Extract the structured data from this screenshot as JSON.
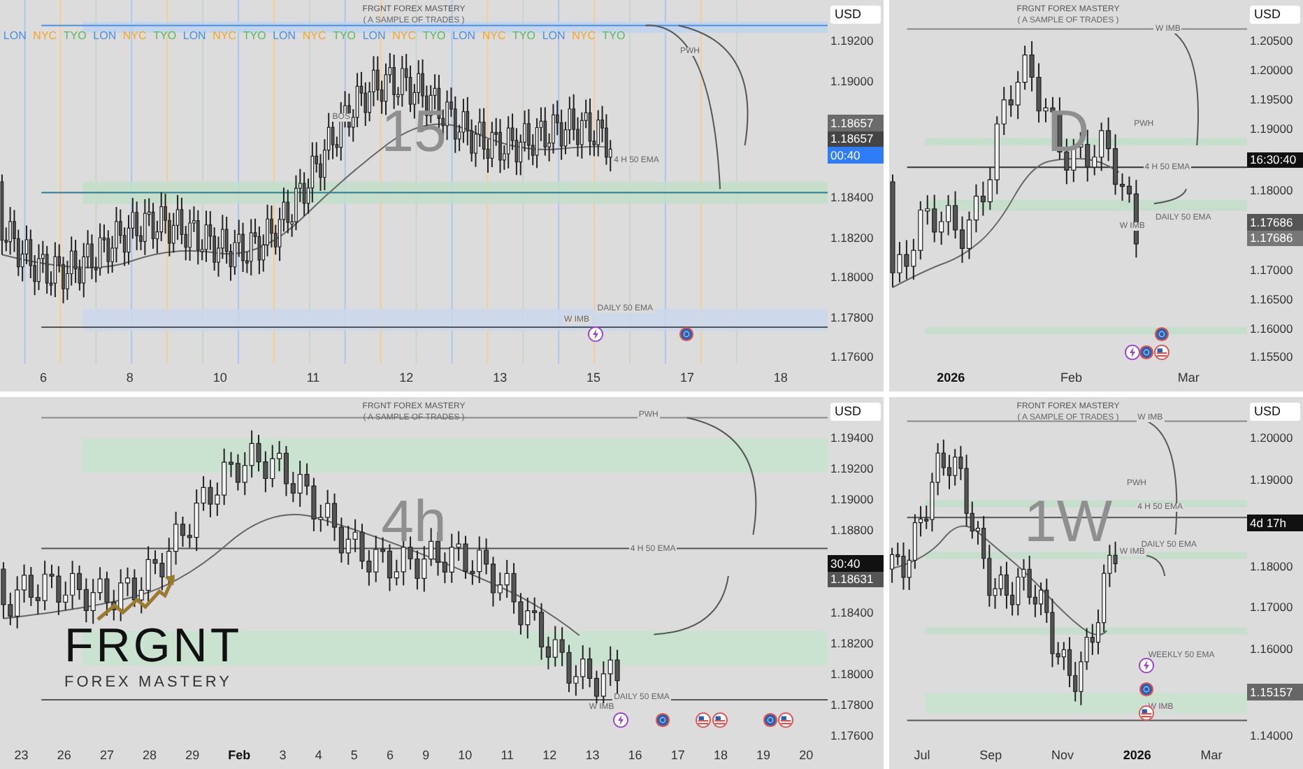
{
  "panels": [
    {
      "timeframe": "15",
      "currency": "USD",
      "title": "FRGNT FOREX MASTERY",
      "subtitle": "( A SAMPLE OF TRADES )",
      "sessions": [
        {
          "text": "LON",
          "color": "#4a90e2"
        },
        {
          "text": "NYC",
          "color": "#f5a623"
        },
        {
          "text": "TYO",
          "color": "#5cb85c"
        },
        {
          "text": "LON",
          "color": "#4a90e2"
        },
        {
          "text": "NYC",
          "color": "#f5a623"
        },
        {
          "text": "TYO",
          "color": "#5cb85c"
        },
        {
          "text": "LON",
          "color": "#4a90e2"
        },
        {
          "text": "NYC",
          "color": "#f5a623"
        },
        {
          "text": "TYO",
          "color": "#5cb85c"
        },
        {
          "text": "LON",
          "color": "#4a90e2"
        },
        {
          "text": "NYC",
          "color": "#f5a623"
        },
        {
          "text": "TYO",
          "color": "#5cb85c"
        },
        {
          "text": "LON",
          "color": "#4a90e2"
        },
        {
          "text": "NYC",
          "color": "#f5a623"
        },
        {
          "text": "TYO",
          "color": "#5cb85c"
        },
        {
          "text": "LON",
          "color": "#4a90e2"
        },
        {
          "text": "NYC",
          "color": "#f5a623"
        },
        {
          "text": "TYO",
          "color": "#5cb85c"
        },
        {
          "text": "LON",
          "color": "#4a90e2"
        },
        {
          "text": "NYC",
          "color": "#f5a623"
        },
        {
          "text": "TYO",
          "color": "#5cb85c"
        }
      ],
      "level_labels": [
        "PWH",
        "BOS",
        "4 H 50 EMA",
        "DAILY 50 EMA",
        "W IMB"
      ],
      "axis": [
        {
          "kind": "tick",
          "text": "1.19200"
        },
        {
          "kind": "tick",
          "text": "1.19000"
        },
        {
          "kind": "tags",
          "tags": [
            {
              "text": "1.18657",
              "color": "#6b6b6b"
            },
            {
              "text": "1.18657",
              "color": "#444444"
            },
            {
              "text": "00:40",
              "color": "#2f7df6"
            }
          ]
        },
        {
          "kind": "tick",
          "text": "1.18400"
        },
        {
          "kind": "tick",
          "text": "1.18200"
        },
        {
          "kind": "tick",
          "text": "1.18000"
        },
        {
          "kind": "tick",
          "text": "1.17800"
        },
        {
          "kind": "tick",
          "text": "1.17600"
        }
      ],
      "time_labels": [
        {
          "text": "6",
          "major": false
        },
        {
          "text": "8",
          "major": false
        },
        {
          "text": "10",
          "major": false
        },
        {
          "text": "11",
          "major": false
        },
        {
          "text": "12",
          "major": false
        },
        {
          "text": "13",
          "major": false
        },
        {
          "text": "15",
          "major": false
        },
        {
          "text": "17",
          "major": false
        },
        {
          "text": "18",
          "major": false
        }
      ]
    },
    {
      "timeframe": "D",
      "currency": "USD",
      "title": "FRGNT FOREX MASTERY",
      "subtitle": "( A SAMPLE OF TRADES )",
      "level_labels": [
        "W IMB",
        "PWH",
        "4 H 50 EMA",
        "DAILY 50 EMA",
        "W IMB"
      ],
      "axis": [
        {
          "kind": "tick",
          "text": "1.20500"
        },
        {
          "kind": "tick",
          "text": "1.20000"
        },
        {
          "kind": "tick",
          "text": "1.19500"
        },
        {
          "kind": "tick",
          "text": "1.19000"
        },
        {
          "kind": "tags",
          "tags": [
            {
              "text": "16:30:40",
              "color": "#111111"
            }
          ]
        },
        {
          "kind": "tick",
          "text": "1.18000"
        },
        {
          "kind": "tags",
          "tags": [
            {
              "text": "1.17686",
              "color": "#555555"
            },
            {
              "text": "1.17686",
              "color": "#777777"
            }
          ]
        },
        {
          "kind": "tick",
          "text": "1.17000"
        },
        {
          "kind": "tick",
          "text": "1.16500"
        },
        {
          "kind": "tick",
          "text": "1.16000"
        },
        {
          "kind": "tick",
          "text": "1.15500"
        }
      ],
      "time_labels": [
        {
          "text": "2026",
          "major": true
        },
        {
          "text": "Feb",
          "major": false
        },
        {
          "text": "Mar",
          "major": false
        }
      ]
    },
    {
      "timeframe": "4h",
      "currency": "USD",
      "title": "FRGNT FOREX MASTERY",
      "subtitle": "( A SAMPLE OF TRADES )",
      "logo": {
        "name": "FRGNT",
        "tagline": "FOREX MASTERY"
      },
      "level_labels": [
        "PWH",
        "4 H 50 EMA",
        "DAILY 50 EMA",
        "W IMB"
      ],
      "axis": [
        {
          "kind": "tick",
          "text": "1.19400"
        },
        {
          "kind": "tick",
          "text": "1.19200"
        },
        {
          "kind": "tick",
          "text": "1.19000"
        },
        {
          "kind": "tick",
          "text": "1.18800"
        },
        {
          "kind": "tags",
          "tags": [
            {
              "text": "30:40",
              "color": "#111111"
            },
            {
              "text": "1.18631",
              "color": "#555555"
            }
          ]
        },
        {
          "kind": "tick",
          "text": "1.18400"
        },
        {
          "kind": "tick",
          "text": "1.18200"
        },
        {
          "kind": "tick",
          "text": "1.18000"
        },
        {
          "kind": "tick",
          "text": "1.17800"
        },
        {
          "kind": "tick",
          "text": "1.17600"
        }
      ],
      "time_labels": [
        {
          "text": "23",
          "major": false
        },
        {
          "text": "26",
          "major": false
        },
        {
          "text": "27",
          "major": false
        },
        {
          "text": "28",
          "major": false
        },
        {
          "text": "29",
          "major": false
        },
        {
          "text": "Feb",
          "major": true
        },
        {
          "text": "3",
          "major": false
        },
        {
          "text": "4",
          "major": false
        },
        {
          "text": "5",
          "major": false
        },
        {
          "text": "6",
          "major": false
        },
        {
          "text": "9",
          "major": false
        },
        {
          "text": "10",
          "major": false
        },
        {
          "text": "11",
          "major": false
        },
        {
          "text": "12",
          "major": false
        },
        {
          "text": "13",
          "major": false
        },
        {
          "text": "16",
          "major": false
        },
        {
          "text": "17",
          "major": false
        },
        {
          "text": "18",
          "major": false
        },
        {
          "text": "19",
          "major": false
        },
        {
          "text": "20",
          "major": false
        }
      ]
    },
    {
      "timeframe": "1W",
      "currency": "USD",
      "title": "FRONT FOREX MASTERY",
      "subtitle": "( A SAMPLE OF TRADES )",
      "level_labels": [
        "W IMB",
        "PWH",
        "4 H 50 EMA",
        "DAILY 50 EMA",
        "W IMB",
        "WEEKLY 50 EMA",
        "W IMB"
      ],
      "axis": [
        {
          "kind": "tick",
          "text": "1.20000"
        },
        {
          "kind": "tick",
          "text": "1.19000"
        },
        {
          "kind": "tags",
          "tags": [
            {
              "text": "4d 17h",
              "color": "#111111"
            }
          ]
        },
        {
          "kind": "tick",
          "text": "1.18000"
        },
        {
          "kind": "tick",
          "text": "1.17000"
        },
        {
          "kind": "tick",
          "text": "1.16000"
        },
        {
          "kind": "tags",
          "tags": [
            {
              "text": "1.15157",
              "color": "#666666"
            }
          ]
        },
        {
          "kind": "tick",
          "text": "1.14000"
        }
      ],
      "time_labels": [
        {
          "text": "Jul",
          "major": false
        },
        {
          "text": "Sep",
          "major": false
        },
        {
          "text": "Nov",
          "major": false
        },
        {
          "text": "2026",
          "major": true
        },
        {
          "text": "Mar",
          "major": false
        }
      ]
    }
  ]
}
